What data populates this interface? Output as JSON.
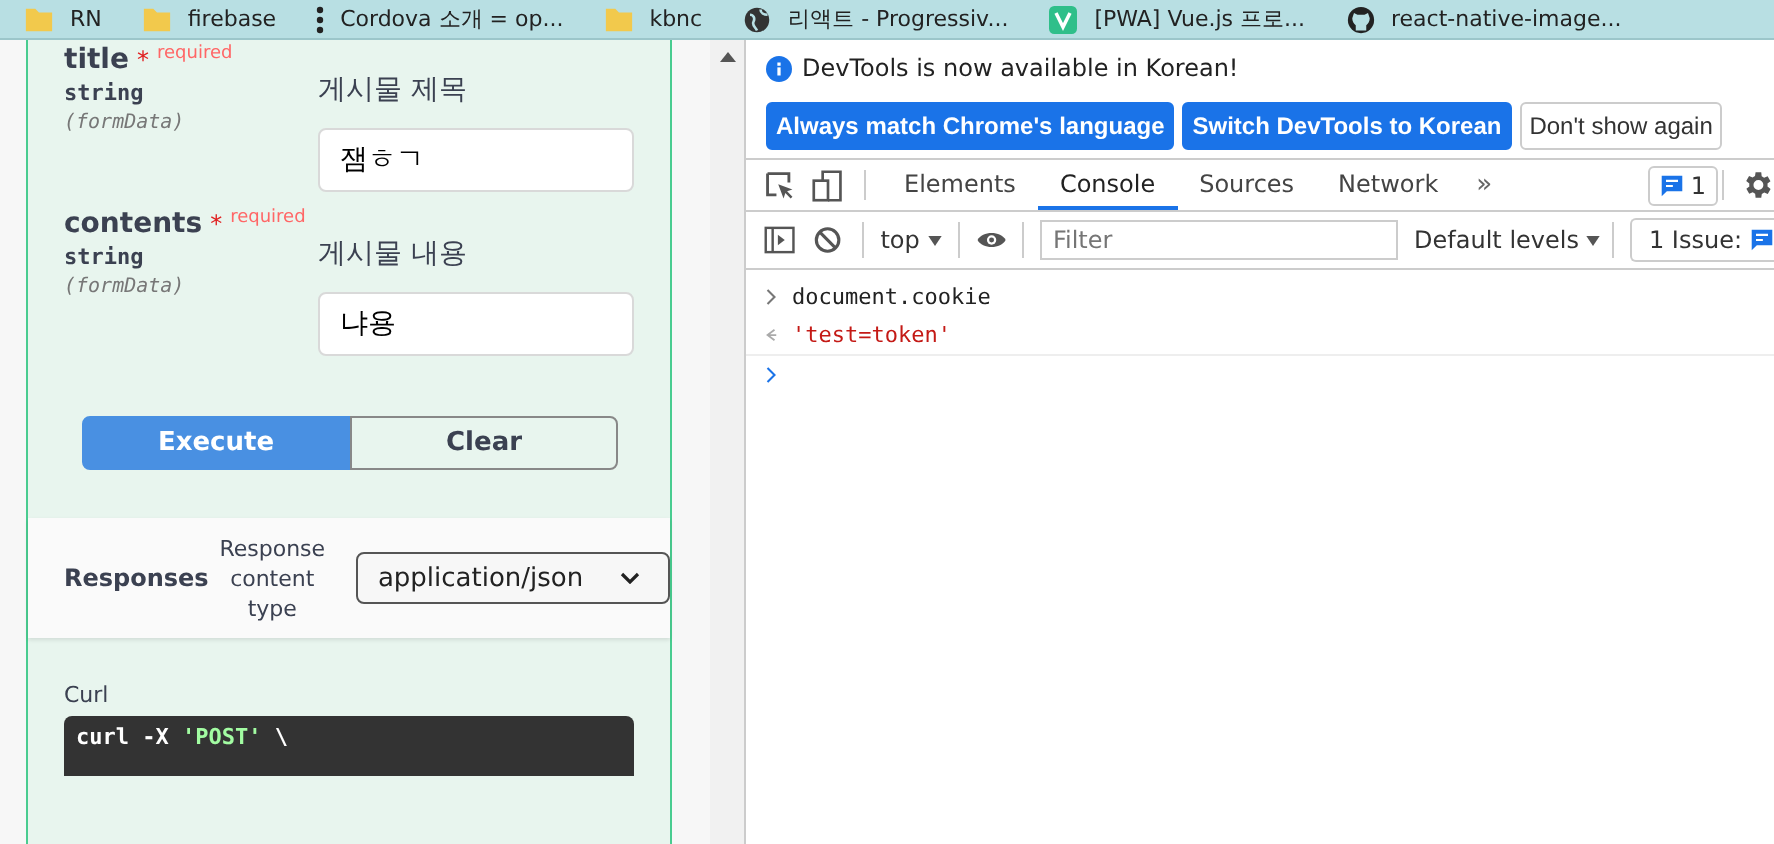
{
  "bookmarks": [
    {
      "kind": "folder",
      "label": "RN"
    },
    {
      "kind": "folder",
      "label": "firebase"
    },
    {
      "kind": "dots",
      "label": "Cordova 소개 = op..."
    },
    {
      "kind": "folder",
      "label": "kbnc"
    },
    {
      "kind": "globe",
      "label": "리액트 - Progressiv..."
    },
    {
      "kind": "vue",
      "label": "[PWA] Vue.js 프로..."
    },
    {
      "kind": "github",
      "label": "react-native-image..."
    }
  ],
  "params": [
    {
      "name": "title",
      "required_mark": "*",
      "required_label": "required",
      "type": "string",
      "location": "(formData)",
      "description": "게시물 제목",
      "value": "잼ㅎㄱ"
    },
    {
      "name": "contents",
      "required_mark": "*",
      "required_label": "required",
      "type": "string",
      "location": "(formData)",
      "description": "게시물 내용",
      "value": "냐용"
    }
  ],
  "actions": [
    {
      "kind": "primary",
      "label": "Execute"
    },
    {
      "kind": "plain",
      "label": "Clear"
    }
  ],
  "responses": {
    "label": "Responses",
    "content_type_label": "Response content type",
    "content_type": "application/json"
  },
  "curl": {
    "label": "Curl",
    "tokens": [
      {
        "kind": "plain",
        "text": "curl -X "
      },
      {
        "kind": "string",
        "text": "'POST'"
      },
      {
        "kind": "plain",
        "text": " \\"
      }
    ]
  },
  "devtools": {
    "infobar": {
      "message": "DevTools is now available in Korean!",
      "buttons": [
        {
          "kind": "primary",
          "label": "Always match Chrome's language"
        },
        {
          "kind": "primary",
          "label": "Switch DevTools to Korean"
        },
        {
          "kind": "plain",
          "label": "Don't show again"
        }
      ]
    },
    "tabs": [
      {
        "label": "Elements",
        "selected": false
      },
      {
        "label": "Console",
        "selected": true
      },
      {
        "label": "Sources",
        "selected": false
      },
      {
        "label": "Network",
        "selected": false
      }
    ],
    "more_tabs": "»",
    "messages_count": "1",
    "context": "top",
    "filter": {
      "placeholder": "Filter"
    },
    "levels": "Default levels",
    "issues": "1 Issue:",
    "console": [
      {
        "kind": "input",
        "text": "document.cookie"
      },
      {
        "kind": "result",
        "text": "'test=token'"
      },
      {
        "kind": "prompt"
      }
    ]
  }
}
